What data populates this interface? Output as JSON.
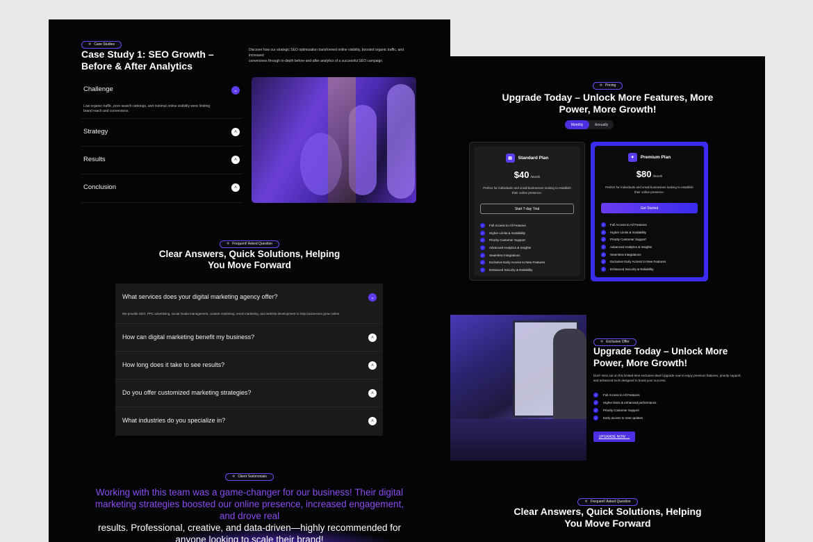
{
  "case_study": {
    "pill": "Case Studies",
    "title_line1": "Case Study 1: SEO Growth –",
    "title_line2": "Before & After Analytics",
    "description_line1": "Discover how our strategic SEO optimization transformed online visibility, boosted organic traffic, and increased",
    "description_line2": "conversions through in-depth before-and-after analytics of a successful SEO campaign.",
    "accordion": [
      {
        "label": "Challenge",
        "body_line1": "Low organic traffic, poor search rankings, and minimal online visibility were limiting",
        "body_line2": "brand reach and conversions."
      },
      {
        "label": "Strategy"
      },
      {
        "label": "Results"
      },
      {
        "label": "Conclusion"
      }
    ]
  },
  "faq": {
    "pill": "Frequent! Asked Question",
    "title_line1": "Clear Answers, Quick Solutions, Helping",
    "title_line2": "You Move Forward",
    "items": [
      {
        "q": "What services does your digital marketing agency offer?",
        "a": "We provide SEO, PPC advertising, social media management, content marketing, email marketing, and website development to help businesses grow online"
      },
      {
        "q": "How can digital marketing benefit my business?"
      },
      {
        "q": "How long does it take to see results?"
      },
      {
        "q": "Do you offer customized marketing strategies?"
      },
      {
        "q": "What industries do you specialize in?"
      }
    ]
  },
  "testimonial": {
    "pill": "Client Testimonials",
    "line1": "Working with this team was a game-changer for our business! Their digital",
    "line2": "marketing strategies boosted our online presence, increased engagement,",
    "line3": "and drove real",
    "line4": "results. Professional, creative, and data-driven—highly recommended for",
    "line5": "anyone looking to scale their brand!"
  },
  "pricing": {
    "pill": "Pricing",
    "title_line1": "Upgrade Today – Unlock More Features, More",
    "title_line2": "Power, More Growth!",
    "toggle": {
      "monthly": "Monthly",
      "annually": "Annually"
    },
    "standard": {
      "name": "Standard Plan",
      "price": "$40",
      "per": "/Month",
      "desc_line1": "Perfect for individuals and small businesses looking to establish",
      "desc_line2": "their online presence.",
      "button": "Start 7-day Trial",
      "features": [
        "Full Access to All Features",
        "Higher Limits & Scalability",
        "Priority Customer Support",
        "Advanced Analytics & Insights",
        "Seamless Integrations",
        "Exclusive Early Access to New Features",
        "Enhanced Security & Reliability"
      ]
    },
    "premium": {
      "name": "Premium Plan",
      "price": "$80",
      "per": "/Month",
      "desc_line1": "Perfect for individuals and small businesses looking to establish",
      "desc_line2": "their online presence.",
      "button": "Get Started",
      "features": [
        "Full Access to All Features",
        "Higher Limits & Scalability",
        "Priority Customer Support",
        "Advanced Analytics & Insights",
        "Seamless Integrations",
        "Exclusive Early Access to New Features",
        "Enhanced Security & Reliability"
      ]
    }
  },
  "exclusive": {
    "pill": "Exclusive Offer",
    "title_line1": "Upgrade Today – Unlock More",
    "title_line2": "Power, More Growth!",
    "desc_line1": "Don't miss out on this limited-time exclusive deal! Upgrade now to enjoy premium features, priority support,",
    "desc_line2": "and advanced tools designed to boost your success.",
    "features": [
      "Full Access to All Features",
      "Higher limits & enhanced performance",
      "Priority Customer Support",
      "Early access to new updates"
    ],
    "button": "UPGRADE NOW →"
  },
  "faq2": {
    "pill": "Frequent! Asked Question",
    "title_line1": "Clear Answers, Quick Solutions, Helping",
    "title_line2": "You Move Forward"
  },
  "colors": {
    "accent": "#5f3df0",
    "panel_bg": "#050505",
    "page_bg": "#e9e9eb",
    "premium_border": "#3a2cf0",
    "testimonial_purple": "#8a4cf0"
  }
}
